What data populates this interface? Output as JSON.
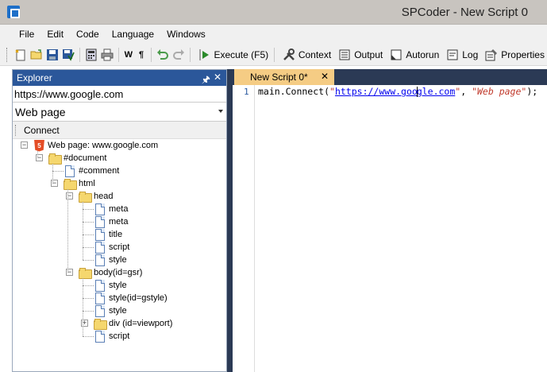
{
  "window": {
    "title": "SPCoder - New Script 0"
  },
  "menu": [
    "File",
    "Edit",
    "Code",
    "Language",
    "Windows"
  ],
  "toolbar": {
    "text_icons": [
      "W",
      "¶"
    ],
    "buttons": {
      "execute": "Execute (F5)",
      "context": "Context",
      "output": "Output",
      "autorun": "Autorun",
      "log": "Log",
      "properties": "Properties"
    }
  },
  "explorer": {
    "title": "Explorer",
    "url_value": "https://www.google.com",
    "type_value": "Web page",
    "connect_label": "Connect",
    "tree": [
      {
        "label": "Web page: www.google.com",
        "icon": "html5-icon",
        "expander": "−"
      },
      {
        "label": "#document",
        "icon": "folder-icon",
        "expander": "−"
      },
      {
        "label": "#comment",
        "icon": "doc-icon"
      },
      {
        "label": "html",
        "icon": "folder-icon",
        "expander": "−"
      },
      {
        "label": "head",
        "icon": "folder-icon",
        "expander": "−"
      },
      {
        "label": "meta",
        "icon": "doc-icon"
      },
      {
        "label": "meta",
        "icon": "doc-icon"
      },
      {
        "label": "title",
        "icon": "doc-icon"
      },
      {
        "label": "script",
        "icon": "doc-icon"
      },
      {
        "label": "style",
        "icon": "doc-icon"
      },
      {
        "label": "body(id=gsr)",
        "icon": "folder-icon",
        "expander": "−"
      },
      {
        "label": "style",
        "icon": "doc-icon"
      },
      {
        "label": "style(id=gstyle)",
        "icon": "doc-icon"
      },
      {
        "label": "style",
        "icon": "doc-icon"
      },
      {
        "label": "div (id=viewport)",
        "icon": "folder-icon",
        "expander": "+"
      },
      {
        "label": "script",
        "icon": "doc-icon"
      }
    ]
  },
  "editor": {
    "tab_label": "New Script 0*",
    "line_number": "1",
    "code": {
      "prefix": "main.Connect(",
      "quote_open": "\"",
      "url_part1": "https://www.goo",
      "url_part2": "gle.com",
      "quote_close": "\"",
      "separator": ", ",
      "arg2": "\"Web page\"",
      "suffix": ");"
    }
  }
}
